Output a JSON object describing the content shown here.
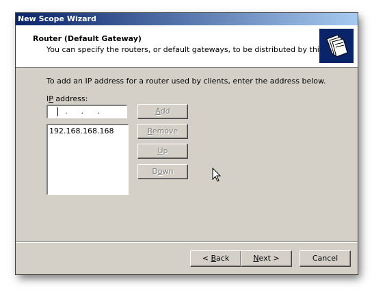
{
  "window": {
    "title": "New Scope Wizard"
  },
  "header": {
    "title": "Router (Default Gateway)",
    "subtitle": "You can specify the routers, or default gateways, to be distributed by this scope.",
    "icon": "folders-icon"
  },
  "body": {
    "instruction": "To add an IP address for a router used by clients, enter the address below.",
    "ip_label_prefix": "I",
    "ip_label_accel": "P",
    "ip_label_suffix": " address:",
    "ip_value": "",
    "router_list": [
      "192.168.168.168"
    ]
  },
  "buttons": {
    "add": {
      "accel": "A",
      "rest": "dd",
      "enabled": false
    },
    "remove": {
      "accel": "R",
      "rest": "emove",
      "enabled": false
    },
    "up": {
      "accel": "U",
      "rest": "p",
      "enabled": false
    },
    "down": {
      "prefix": "D",
      "accel": "o",
      "rest": "wn",
      "enabled": false
    }
  },
  "footer": {
    "back": {
      "prefix": "< ",
      "accel": "B",
      "rest": "ack"
    },
    "next": {
      "accel": "N",
      "rest": "ext >"
    },
    "cancel": "Cancel"
  }
}
